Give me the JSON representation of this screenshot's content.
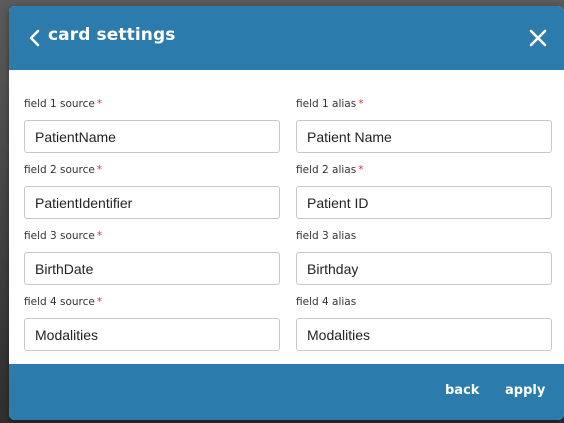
{
  "dialog": {
    "title": "card settings",
    "accent_color": "#2b7bad",
    "required_color": "#d9363e",
    "icons": {
      "back": "chevron-left-icon",
      "close": "close-icon"
    }
  },
  "fields": [
    {
      "label": "field 1 source",
      "required": true,
      "value": "PatientName"
    },
    {
      "label": "field 1 alias",
      "required": true,
      "value": "Patient Name"
    },
    {
      "label": "field 2 source",
      "required": true,
      "value": "PatientIdentifier"
    },
    {
      "label": "field 2 alias",
      "required": true,
      "value": "Patient ID"
    },
    {
      "label": "field 3 source",
      "required": true,
      "value": "BirthDate"
    },
    {
      "label": "field 3 alias",
      "required": false,
      "value": "Birthday"
    },
    {
      "label": "field 4 source",
      "required": true,
      "value": "Modalities"
    },
    {
      "label": "field 4 alias",
      "required": false,
      "value": "Modalities"
    }
  ],
  "footer": {
    "back_label": "back",
    "apply_label": "apply"
  }
}
